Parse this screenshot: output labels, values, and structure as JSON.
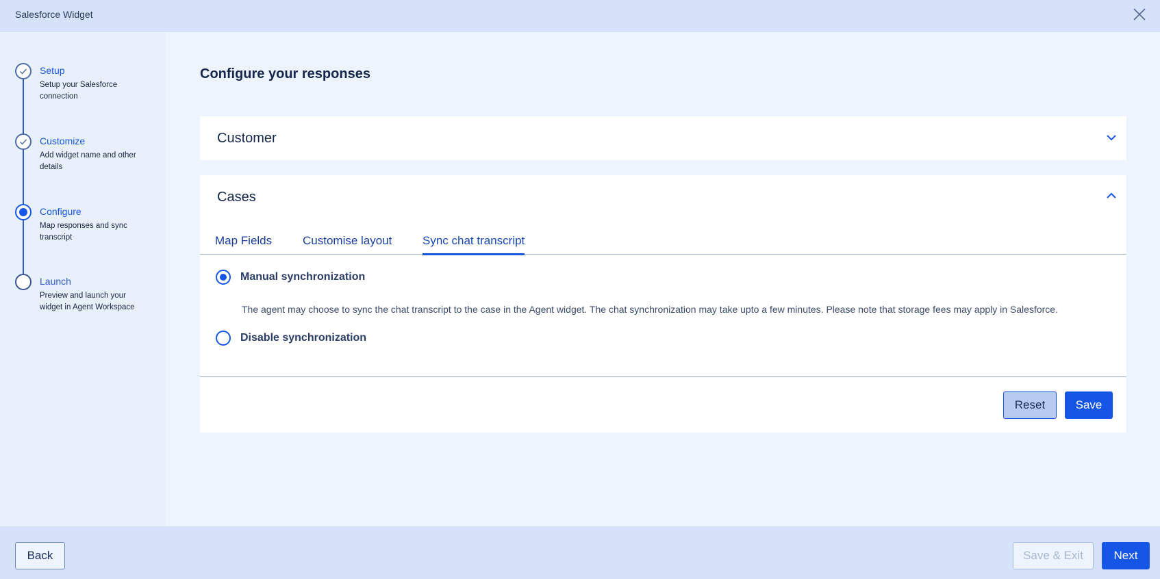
{
  "app": {
    "title": "Salesforce Widget"
  },
  "steps": [
    {
      "title": "Setup",
      "description": "Setup your Salesforce connection",
      "status": "done"
    },
    {
      "title": "Customize",
      "description": "Add widget name and other details",
      "status": "done"
    },
    {
      "title": "Configure",
      "description": "Map responses and sync transcript",
      "status": "active"
    },
    {
      "title": "Launch",
      "description": "Preview and launch your widget in Agent Workspace",
      "status": "todo"
    }
  ],
  "main": {
    "title": "Configure your responses",
    "customer_panel": {
      "title": "Customer",
      "expanded": false
    },
    "cases_panel": {
      "title": "Cases",
      "expanded": true,
      "tabs": [
        {
          "label": "Map Fields",
          "active": false
        },
        {
          "label": "Customise layout",
          "active": false
        },
        {
          "label": "Sync chat transcript",
          "active": true
        }
      ],
      "options": [
        {
          "label": "Manual synchronization",
          "checked": true,
          "description": "The agent may choose to sync the chat transcript to the case in the Agent widget. The chat synchronization may take upto a few minutes. Please note that storage fees may apply in Salesforce."
        },
        {
          "label": "Disable synchronization",
          "checked": false
        }
      ],
      "reset_label": "Reset",
      "save_label": "Save"
    }
  },
  "footer": {
    "back_label": "Back",
    "save_exit_label": "Save & Exit",
    "next_label": "Next"
  },
  "colors": {
    "accent": "#1656e6",
    "topbar": "#d5e2f9",
    "background": "#eef4fd"
  }
}
